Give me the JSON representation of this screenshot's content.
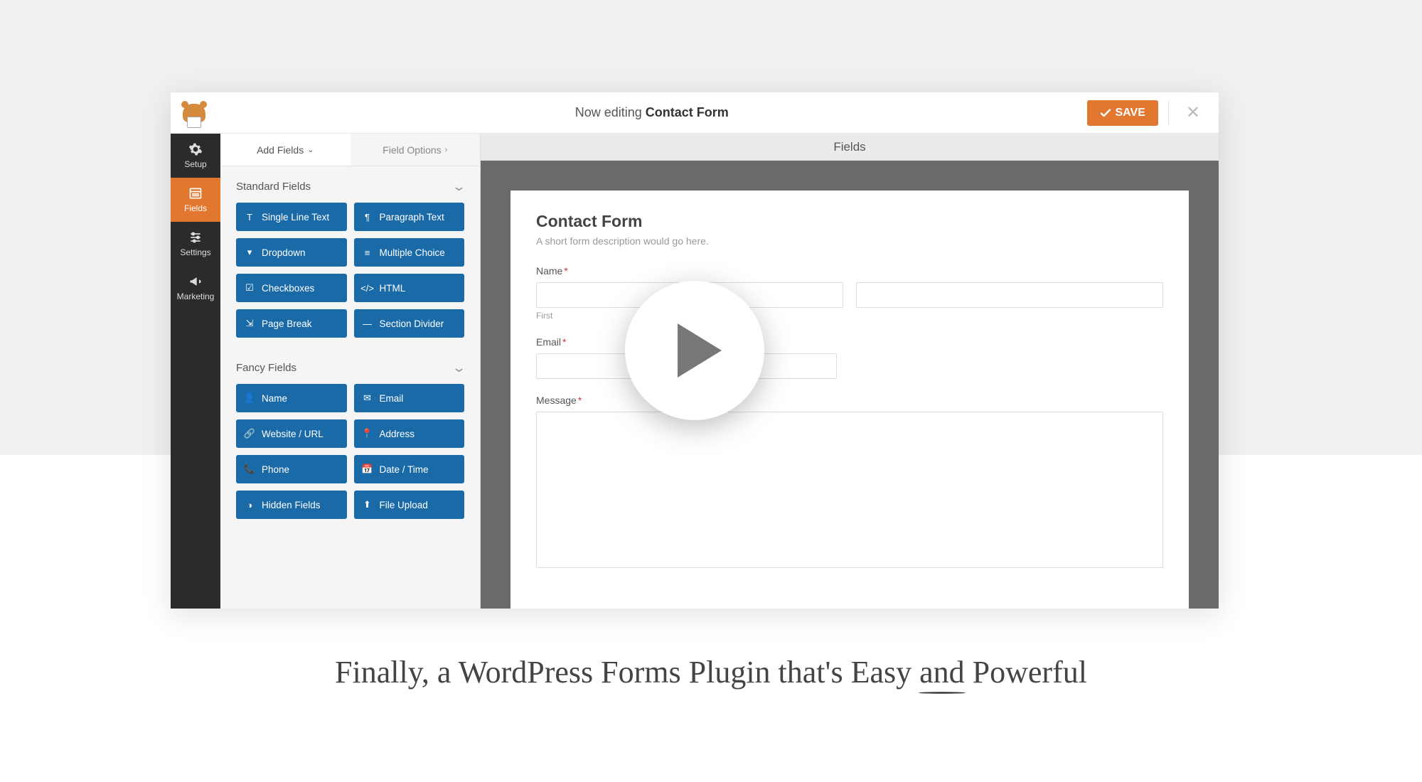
{
  "topbar": {
    "editing_prefix": "Now editing ",
    "editing_name": "Contact Form",
    "save_label": "SAVE"
  },
  "sidebar": {
    "items": [
      {
        "label": "Setup"
      },
      {
        "label": "Fields"
      },
      {
        "label": "Settings"
      },
      {
        "label": "Marketing"
      }
    ]
  },
  "fields_panel": {
    "title": "Fields",
    "tabs": {
      "add": "Add Fields",
      "options": "Field Options"
    },
    "groups": [
      {
        "title": "Standard Fields",
        "items": [
          "Single Line Text",
          "Paragraph Text",
          "Dropdown",
          "Multiple Choice",
          "Checkboxes",
          "HTML",
          "Page Break",
          "Section Divider"
        ]
      },
      {
        "title": "Fancy Fields",
        "items": [
          "Name",
          "Email",
          "Website / URL",
          "Address",
          "Phone",
          "Date / Time",
          "Hidden Fields",
          "File Upload"
        ]
      }
    ]
  },
  "preview": {
    "header": "Fields",
    "form_title": "Contact Form",
    "form_desc": "A short form description would go here.",
    "labels": {
      "name": "Name",
      "first": "First",
      "email": "Email",
      "message": "Message"
    }
  },
  "tagline": {
    "pre": "Finally, a WordPress Forms Plugin that's Easy ",
    "underlined": "and",
    "post": " Powerful"
  },
  "colors": {
    "accent": "#e27730",
    "field_button": "#1a6aa8",
    "sidebar_bg": "#2b2b2b"
  }
}
